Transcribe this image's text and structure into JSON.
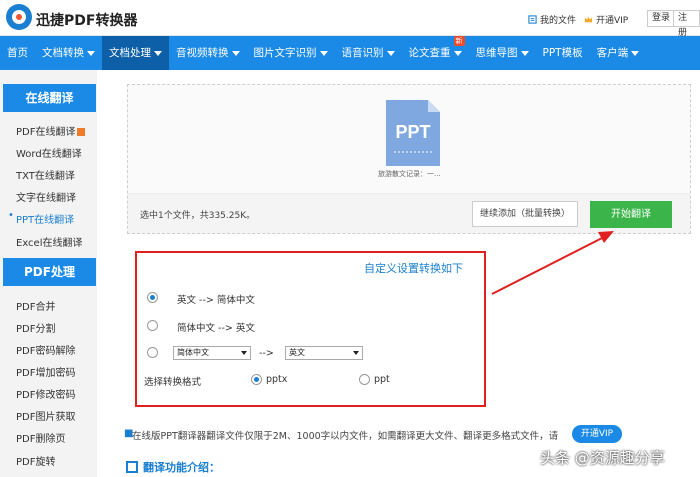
{
  "header": {
    "app_title": "迅捷PDF转换器",
    "my_files": "我的文件",
    "vip": "开通VIP",
    "login": "登录",
    "register": "注册"
  },
  "nav": {
    "items": [
      {
        "label": "首页",
        "caret": false
      },
      {
        "label": "文档转换",
        "caret": true
      },
      {
        "label": "文档处理",
        "caret": true,
        "active": true
      },
      {
        "label": "音视频转换",
        "caret": true
      },
      {
        "label": "图片文字识别",
        "caret": true
      },
      {
        "label": "语音识别",
        "caret": true
      },
      {
        "label": "论文查重",
        "caret": true,
        "badge": "新"
      },
      {
        "label": "思维导图",
        "caret": true
      },
      {
        "label": "PPT模板",
        "caret": false
      },
      {
        "label": "客户端",
        "caret": true
      }
    ]
  },
  "sidebar": {
    "section1_title": "在线翻译",
    "section1_items": [
      "PDF在线翻译",
      "Word在线翻译",
      "TXT在线翻译",
      "文字在线翻译",
      "PPT在线翻译",
      "Excel在线翻译"
    ],
    "section2_title": "PDF处理",
    "section2_items": [
      "PDF合并",
      "PDF分割",
      "PDF密码解除",
      "PDF增加密码",
      "PDF修改密码",
      "PDF图片获取",
      "PDF删除页",
      "PDF旋转"
    ]
  },
  "upload": {
    "file_type": "PPT",
    "file_name": "旅游散文记录：一...",
    "file_count": "选中1个文件，共335.25K。",
    "add_button": "继续添加（批量转换）",
    "start_button": "开始翻译"
  },
  "settings": {
    "link": "自定义设置转换如下",
    "option1": "英文 --> 简体中文",
    "option2": "简体中文 --> 英文",
    "select_from": "简体中文",
    "arrow": "-->",
    "select_to": "英文",
    "format_label": "选择转换格式",
    "format_pptx": "pptx",
    "format_ppt": "ppt"
  },
  "notice": {
    "text": "在线版PPT翻译器翻译文件仅限于2M、1000字以内文件，如需翻译更大文件、翻译更多格式文件，请",
    "vip_button": "开通VIP"
  },
  "intro": {
    "title": "翻译功能介绍："
  },
  "watermark": "头条 @资源趣分享",
  "colors": {
    "primary": "#1a8ae6",
    "nav_active": "#0d5fa8",
    "start_green": "#3bb54a",
    "annotation_red": "#e02020"
  }
}
